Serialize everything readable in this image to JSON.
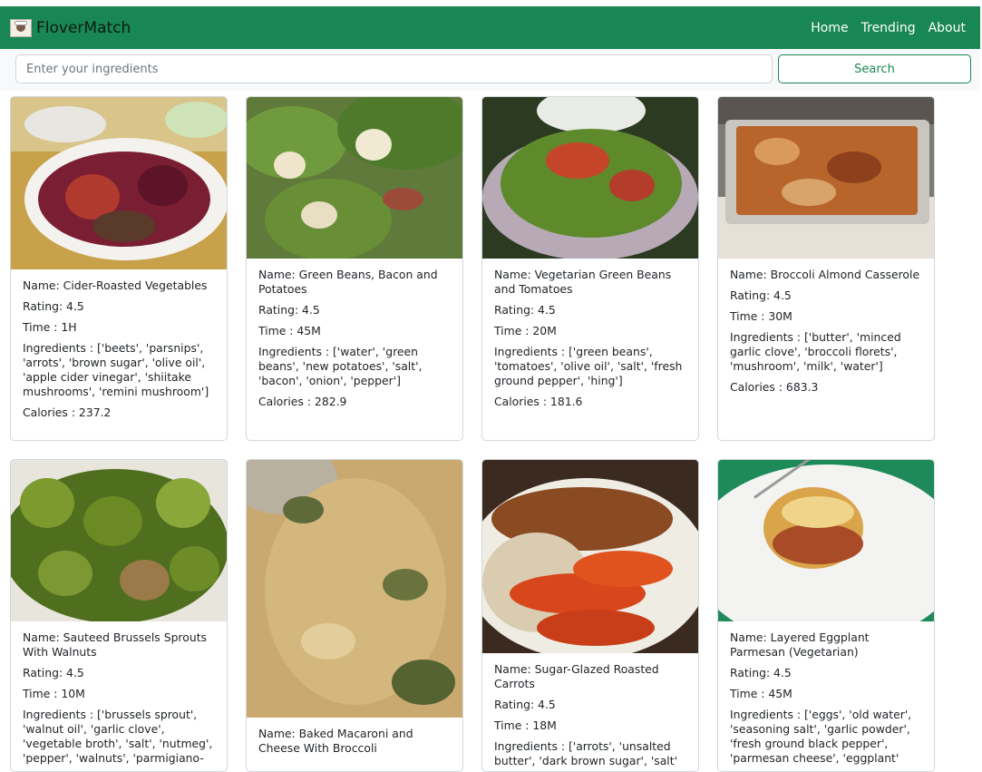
{
  "brand": {
    "name": "FloverMatch"
  },
  "nav": {
    "home": "Home",
    "trending": "Trending",
    "about": "About"
  },
  "search": {
    "placeholder": "Enter your ingredients",
    "value": "",
    "button": "Search"
  },
  "recipes": [
    {
      "name": "Name: Cider-Roasted Vegetables",
      "rating": "Rating: 4.5",
      "time": "Time : 1H",
      "ingredients": "Ingredients : ['beets', 'parsnips', 'arrots', 'brown sugar', 'olive oil', 'apple cider vinegar', 'shiitake mushrooms', 'remini mushroom']",
      "calories": "Calories : 237.2"
    },
    {
      "name": "Name: Green Beans, Bacon and Potatoes",
      "rating": "Rating: 4.5",
      "time": "Time : 45M",
      "ingredients": "Ingredients : ['water', 'green beans', 'new potatoes', 'salt', 'bacon', 'onion', 'pepper']",
      "calories": "Calories : 282.9"
    },
    {
      "name": "Name: Vegetarian Green Beans and Tomatoes",
      "rating": "Rating: 4.5",
      "time": "Time : 20M",
      "ingredients": "Ingredients : ['green beans', 'tomatoes', 'olive oil', 'salt', 'fresh ground pepper', 'hing']",
      "calories": "Calories : 181.6"
    },
    {
      "name": "Name: Broccoli Almond Casserole",
      "rating": "Rating: 4.5",
      "time": "Time : 30M",
      "ingredients": "Ingredients : ['butter', 'minced garlic clove', 'broccoli florets', 'mushroom', 'milk', 'water']",
      "calories": "Calories : 683.3"
    },
    {
      "name": "Name: Sauteed Brussels Sprouts With Walnuts",
      "rating": "Rating: 4.5",
      "time": "Time : 10M",
      "ingredients": "Ingredients : ['brussels sprout', 'walnut oil', 'garlic clove', 'vegetable broth', 'salt', 'nutmeg', 'pepper', 'walnuts', 'parmigiano-",
      "calories": ""
    },
    {
      "name": "Name: Baked Macaroni and Cheese With Broccoli",
      "rating": "",
      "time": "",
      "ingredients": "",
      "calories": ""
    },
    {
      "name": "Name: Sugar-Glazed Roasted Carrots",
      "rating": "Rating: 4.5",
      "time": "Time : 18M",
      "ingredients": "Ingredients : ['arrots', 'unsalted butter', 'dark brown sugar', 'salt'",
      "calories": ""
    },
    {
      "name": "Name: Layered Eggplant Parmesan (Vegetarian)",
      "rating": "Rating: 4.5",
      "time": "Time : 45M",
      "ingredients": "Ingredients : ['eggs', 'old water', 'seasoning salt', 'garlic powder', 'fresh ground black pepper', 'parmesan cheese', 'eggplant'",
      "calories": ""
    }
  ]
}
